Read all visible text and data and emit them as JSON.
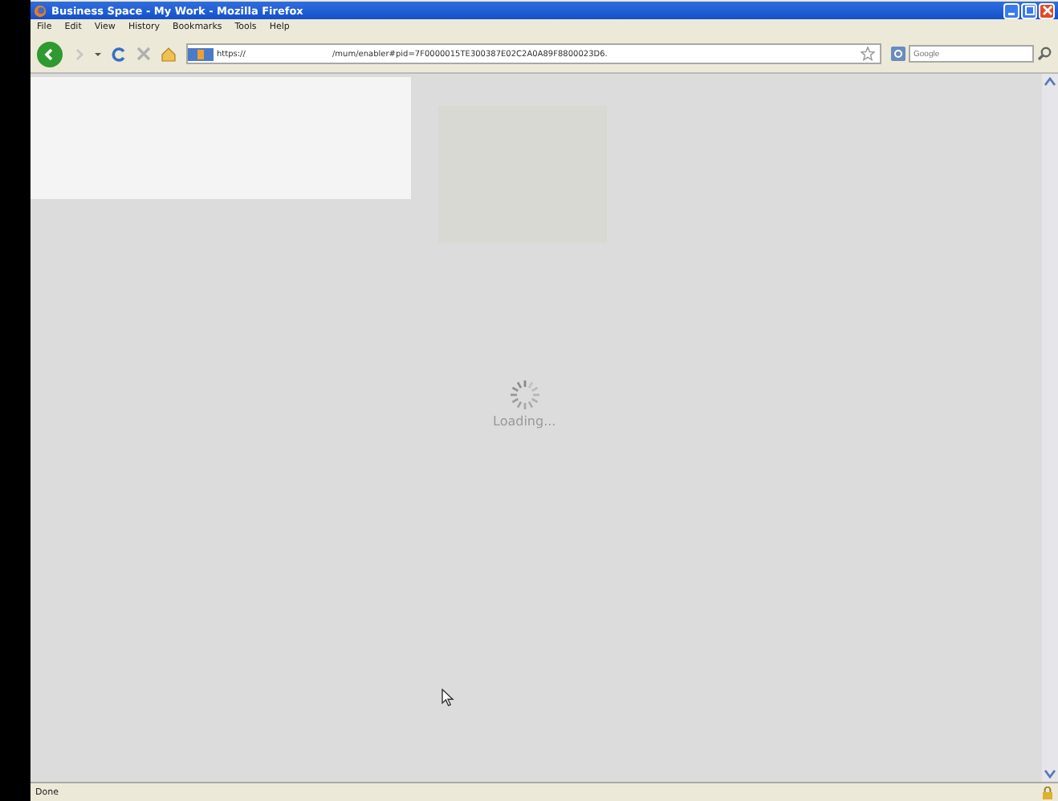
{
  "window": {
    "title": "Business Space - My Work - Mozilla Firefox"
  },
  "menu": [
    "File",
    "Edit",
    "View",
    "History",
    "Bookmarks",
    "Tools",
    "Help"
  ],
  "address": {
    "scheme": "https://",
    "path": "/mum/enabler#pid=7F0000015TE300387E02C2A0A89F8800023D6."
  },
  "search": {
    "placeholder": "Google"
  },
  "loading": {
    "text": "Loading..."
  },
  "status_bar": {
    "text": "Done"
  }
}
